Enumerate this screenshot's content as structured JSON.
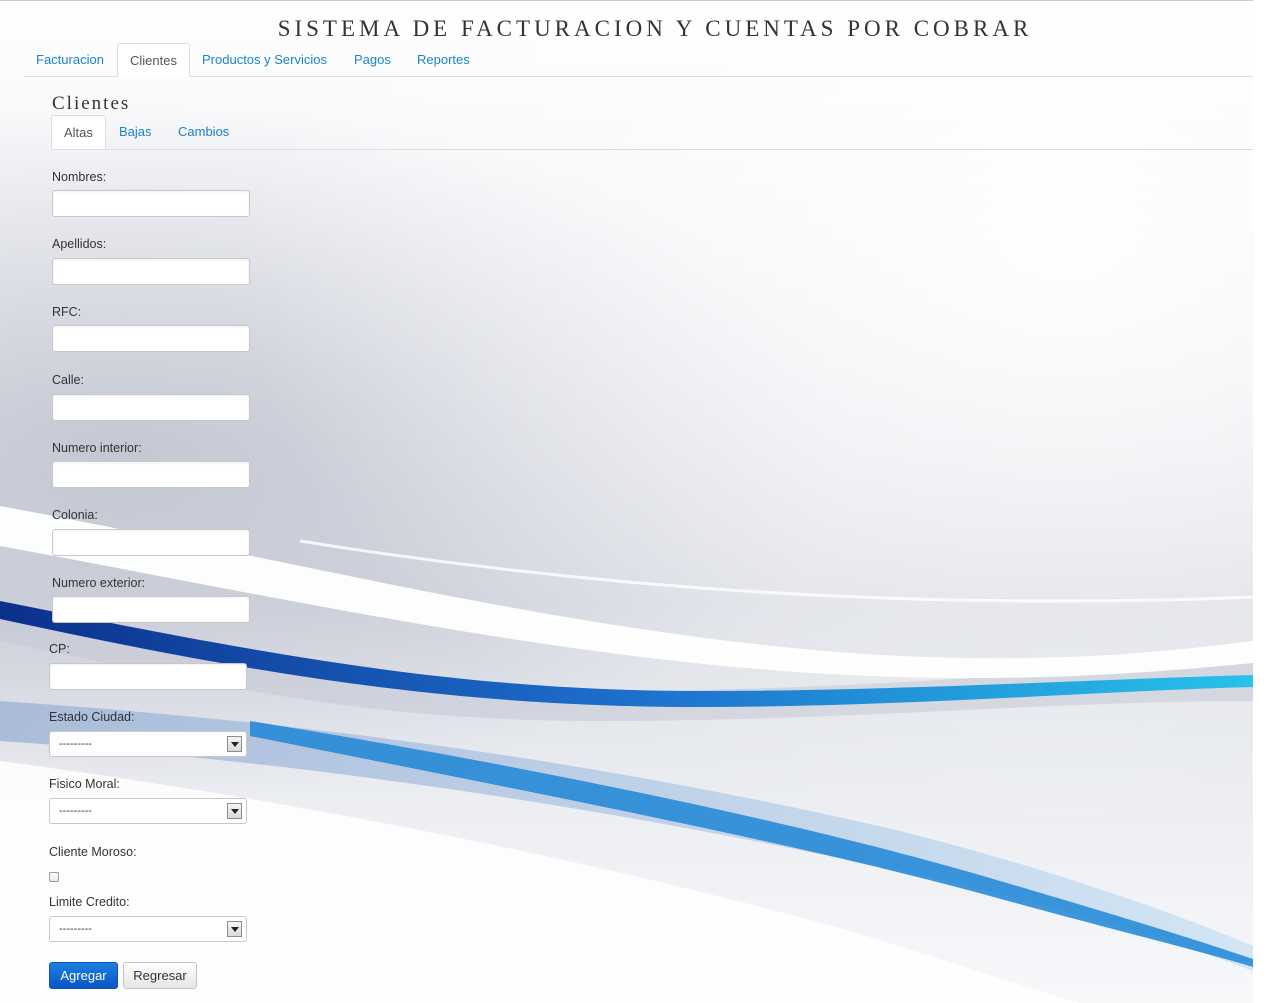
{
  "app": {
    "title": "SISTEMA DE FACTURACION Y CUENTAS POR COBRAR"
  },
  "main_tabs": [
    {
      "label": "Facturacion",
      "active": false
    },
    {
      "label": "Clientes",
      "active": true
    },
    {
      "label": "Productos y Servicios",
      "active": false
    },
    {
      "label": "Pagos",
      "active": false
    },
    {
      "label": "Reportes",
      "active": false
    }
  ],
  "section": {
    "title": "Clientes"
  },
  "sub_tabs": [
    {
      "label": "Altas",
      "active": true
    },
    {
      "label": "Bajas",
      "active": false
    },
    {
      "label": "Cambios",
      "active": false
    }
  ],
  "form": {
    "fields": [
      {
        "label": "Nombres:",
        "value": ""
      },
      {
        "label": "Apellidos:",
        "value": ""
      },
      {
        "label": "RFC:",
        "value": ""
      },
      {
        "label": "Calle:",
        "value": ""
      },
      {
        "label": "Numero interior:",
        "value": ""
      },
      {
        "label": "Colonia:",
        "value": ""
      },
      {
        "label": "Numero exterior:",
        "value": ""
      },
      {
        "label": "CP:",
        "value": ""
      }
    ],
    "estado_ciudad": {
      "label": "Estado Ciudad:",
      "value": "---------"
    },
    "fisico_moral": {
      "label": "Fisico Moral:",
      "value": "---------"
    },
    "cliente_moroso": {
      "label": "Cliente Moroso:",
      "checked": false
    },
    "limite_credito": {
      "label": "Limite Credito:",
      "value": "---------"
    }
  },
  "buttons": {
    "submit_label": "Agregar",
    "back_label": "Regresar"
  },
  "colors": {
    "link": "#1a84c7",
    "primary_button": "#0a55c4",
    "wave_accent": "#27b4e6",
    "wave_dark": "#0c2f8c"
  }
}
